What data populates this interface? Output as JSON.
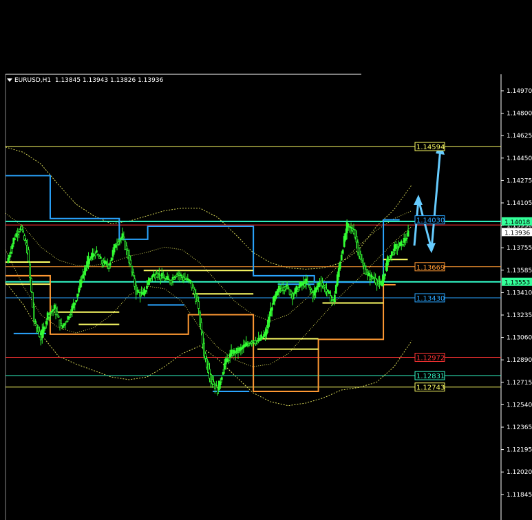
{
  "header": {
    "symbol": "EURUSD,H1",
    "ohlc": "1.13845 1.13943 1.13826 1.13936"
  },
  "colors": {
    "background": "#000000",
    "axis": "#ffffff",
    "candles": "#33ff33",
    "level_yellow": "#ffff66",
    "level_orange": "#ff9933",
    "level_red": "#ff3333",
    "level_blue": "#2aa5ff",
    "level_cyan": "#33ffcc",
    "channel_dotted": "#ffff66",
    "forecast_arrow": "#66ccff"
  },
  "chart_data": {
    "type": "candlestick",
    "symbol": "EURUSD",
    "timeframe": "H1",
    "ylim": [
      1.1172,
      1.1515
    ],
    "y_ticks": [
      "1.14970",
      "1.14800",
      "1.14625",
      "1.14450",
      "1.14275",
      "1.14105",
      "1.13930",
      "1.13755",
      "1.13585",
      "1.13410",
      "1.13235",
      "1.13060",
      "1.12890",
      "1.12715",
      "1.12540",
      "1.12365",
      "1.12195",
      "1.12020",
      "1.11845"
    ],
    "price_labels": [
      {
        "text": "1.14594",
        "value": 1.14594,
        "color": "#ffff66",
        "bg": "#000000"
      },
      {
        "text": "1.14030",
        "value": 1.1403,
        "color": "#2aa5ff",
        "bg": "#000000"
      },
      {
        "text": "1.13669",
        "value": 1.13669,
        "color": "#ff9933",
        "bg": "#000000"
      },
      {
        "text": "1.13430",
        "value": 1.1343,
        "color": "#2aa5ff",
        "bg": "#000000"
      },
      {
        "text": "1.12972",
        "value": 1.12972,
        "color": "#ff3333",
        "bg": "#000000"
      },
      {
        "text": "1.12831",
        "value": 1.12831,
        "color": "#33ffcc",
        "bg": "#000000"
      },
      {
        "text": "1.12743",
        "value": 1.12743,
        "color": "#ffff66",
        "bg": "#000000"
      }
    ],
    "axis_markers": [
      {
        "text": "1.14018",
        "value": 1.14018,
        "bg": "#33ff99",
        "color": "#000000"
      },
      {
        "text": "1.13936",
        "value": 1.13936,
        "bg": "#ffffff",
        "color": "#000000"
      },
      {
        "text": "1.13553",
        "value": 1.13553,
        "bg": "#33ff99",
        "color": "#000000"
      }
    ],
    "horizontal_lines": [
      {
        "value": 1.14594,
        "color": "#ffff66",
        "from": 0.0,
        "to": 1.0,
        "width": 1
      },
      {
        "value": 1.14018,
        "color": "#33ffcc",
        "from": 0.0,
        "to": 1.0,
        "width": 2
      },
      {
        "value": 1.1399,
        "color": "#ff3333",
        "from": 0.0,
        "to": 1.0,
        "width": 1
      },
      {
        "value": 1.13669,
        "color": "#ff9933",
        "from": 0.0,
        "to": 1.0,
        "width": 1
      },
      {
        "value": 1.13553,
        "color": "#33ffcc",
        "from": 0.0,
        "to": 1.0,
        "width": 2
      },
      {
        "value": 1.1343,
        "color": "#2aa5ff",
        "from": 0.0,
        "to": 1.0,
        "width": 1
      },
      {
        "value": 1.12972,
        "color": "#ff3333",
        "from": 0.0,
        "to": 1.0,
        "width": 1
      },
      {
        "value": 1.12831,
        "color": "#33ffcc",
        "from": 0.0,
        "to": 1.0,
        "width": 1
      },
      {
        "value": 1.12743,
        "color": "#ffff66",
        "from": 0.0,
        "to": 1.0,
        "width": 1
      }
    ],
    "step_lines": [
      {
        "name": "blue-upper",
        "color": "#2aa5ff",
        "points": [
          [
            0,
            1.1437
          ],
          [
            0.11,
            1.1437
          ],
          [
            0.11,
            1.1404
          ],
          [
            0.28,
            1.1404
          ],
          [
            0.28,
            1.1388
          ],
          [
            0.35,
            1.1388
          ],
          [
            0.35,
            1.1398
          ],
          [
            0.45,
            1.1398
          ],
          [
            0.45,
            1.1398
          ],
          [
            0.61,
            1.1398
          ],
          [
            0.61,
            1.136
          ],
          [
            0.76,
            1.136
          ],
          [
            0.76,
            1.1355
          ],
          [
            0.93,
            1.1355
          ],
          [
            0.93,
            1.1403
          ],
          [
            0.97,
            1.1403
          ]
        ]
      },
      {
        "name": "orange-lower",
        "color": "#ff9933",
        "points": [
          [
            0,
            1.136
          ],
          [
            0.11,
            1.136
          ],
          [
            0.11,
            1.1315
          ],
          [
            0.45,
            1.1315
          ],
          [
            0.45,
            1.133
          ],
          [
            0.61,
            1.133
          ],
          [
            0.61,
            1.1271
          ],
          [
            0.77,
            1.1271
          ],
          [
            0.77,
            1.1311
          ],
          [
            0.93,
            1.1311
          ],
          [
            0.93,
            1.1353
          ],
          [
            0.96,
            1.1353
          ]
        ]
      }
    ],
    "segments": [
      {
        "color": "#ffff66",
        "x0": 0.0,
        "x1": 0.11,
        "value": 1.13705
      },
      {
        "color": "#ffff66",
        "x0": 0.0,
        "x1": 0.11,
        "value": 1.13535
      },
      {
        "color": "#ffff66",
        "x0": 0.12,
        "x1": 0.28,
        "value": 1.1332
      },
      {
        "color": "#ffff66",
        "x0": 0.18,
        "x1": 0.28,
        "value": 1.13225
      },
      {
        "color": "#ffff66",
        "x0": 0.34,
        "x1": 0.61,
        "value": 1.1364
      },
      {
        "color": "#ffff66",
        "x0": 0.46,
        "x1": 0.61,
        "value": 1.1346
      },
      {
        "color": "#ffff66",
        "x0": 0.62,
        "x1": 0.77,
        "value": 1.13115
      },
      {
        "color": "#ffff66",
        "x0": 0.62,
        "x1": 0.77,
        "value": 1.13035
      },
      {
        "color": "#ffff66",
        "x0": 0.78,
        "x1": 0.93,
        "value": 1.1339
      },
      {
        "color": "#ffff66",
        "x0": 0.93,
        "x1": 0.99,
        "value": 1.13725
      },
      {
        "color": "#2aa5ff",
        "x0": 0.02,
        "x1": 0.1,
        "value": 1.13155
      },
      {
        "color": "#2aa5ff",
        "x0": 0.35,
        "x1": 0.44,
        "value": 1.13375
      },
      {
        "color": "#2aa5ff",
        "x0": 0.51,
        "x1": 0.6,
        "value": 1.1271
      },
      {
        "color": "#2aa5ff",
        "x0": 0.67,
        "x1": 0.76,
        "value": 1.13535
      }
    ],
    "channels": [
      {
        "name": "outer-upper",
        "color": "#ffff66",
        "dash": "2,2",
        "values": [
          1.1459,
          1.1455,
          1.1446,
          1.143,
          1.1415,
          1.1406,
          1.14,
          1.1402,
          1.1406,
          1.141,
          1.1412,
          1.1412,
          1.1405,
          1.1392,
          1.1378,
          1.137,
          1.1366,
          1.1365,
          1.1366,
          1.137,
          1.138,
          1.1398,
          1.1411,
          1.143
        ]
      },
      {
        "name": "outer-lower",
        "color": "#ffff66",
        "dash": "2,2",
        "values": [
          1.1355,
          1.1338,
          1.1315,
          1.1298,
          1.1292,
          1.1287,
          1.1282,
          1.128,
          1.1282,
          1.129,
          1.13,
          1.1306,
          1.1296,
          1.1283,
          1.127,
          1.1263,
          1.126,
          1.1262,
          1.1266,
          1.1272,
          1.1274,
          1.1278,
          1.129,
          1.131
        ]
      },
      {
        "name": "inner-upper",
        "color": "#ffff66",
        "dash": "1,2",
        "values": [
          1.1408,
          1.1398,
          1.1382,
          1.1372,
          1.1368,
          1.1368,
          1.137,
          1.1375,
          1.1378,
          1.1382,
          1.138,
          1.137,
          1.1355,
          1.134,
          1.133,
          1.1325,
          1.133,
          1.1342,
          1.1356,
          1.137,
          1.1383,
          1.1395,
          1.1404,
          1.141
        ]
      },
      {
        "name": "inner-lower",
        "color": "#ffff66",
        "dash": "1,2",
        "values": [
          1.138,
          1.1352,
          1.133,
          1.132,
          1.1316,
          1.132,
          1.133,
          1.1345,
          1.1352,
          1.135,
          1.134,
          1.132,
          1.1305,
          1.1295,
          1.129,
          1.1292,
          1.13,
          1.1315,
          1.133,
          1.1345,
          1.1358,
          1.1372,
          1.1386,
          1.1398
        ]
      }
    ],
    "price_path": [
      1.137,
      1.1388,
      1.1398,
      1.138,
      1.1325,
      1.1312,
      1.133,
      1.1335,
      1.132,
      1.1328,
      1.134,
      1.1358,
      1.1372,
      1.1378,
      1.137,
      1.1368,
      1.1385,
      1.139,
      1.1372,
      1.1348,
      1.1345,
      1.1358,
      1.1362,
      1.1358,
      1.1356,
      1.1362,
      1.1358,
      1.1355,
      1.134,
      1.13,
      1.128,
      1.1272,
      1.1292,
      1.13,
      1.1302,
      1.1306,
      1.131,
      1.131,
      1.1315,
      1.1338,
      1.135,
      1.1352,
      1.1345,
      1.1352,
      1.1355,
      1.1345,
      1.1356,
      1.1348,
      1.134,
      1.1372,
      1.1398,
      1.1395,
      1.1372,
      1.136,
      1.1358,
      1.1352,
      1.1372,
      1.1381,
      1.1384,
      1.1392
    ],
    "forecast_arrow": [
      [
        0.975,
        1.138
      ],
      [
        0.99,
        1.141
      ],
      [
        1.005,
        1.137
      ],
      [
        1.04,
        1.1455
      ]
    ]
  }
}
